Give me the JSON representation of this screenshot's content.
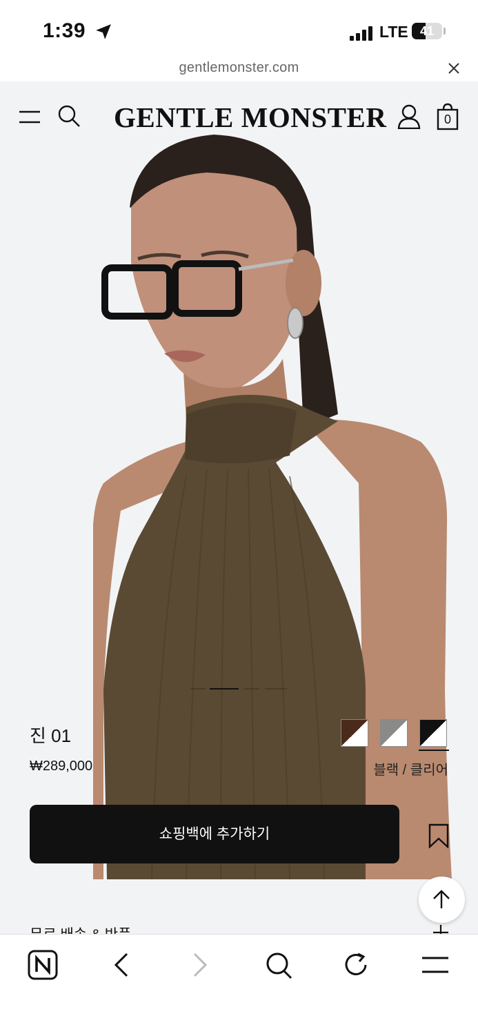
{
  "status_bar": {
    "time": "1:39",
    "network": "LTE",
    "battery": "41"
  },
  "browser": {
    "url": "gentlemonster.com"
  },
  "site": {
    "brand": "GENTLE MONSTER",
    "cart_count": "0"
  },
  "product": {
    "name": "진 01",
    "price": "₩289,000",
    "selected_color": "블랙 / 클리어",
    "add_to_bag": "쇼핑백에 추가하기",
    "swatches": [
      {
        "color_a": "#4a2a1a",
        "color_b": "#ffffff"
      },
      {
        "color_a": "#8a8a88",
        "color_b": "#ffffff"
      },
      {
        "color_a": "#111111",
        "color_b": "#ffffff"
      }
    ],
    "image_count": 4,
    "image_index": 1
  },
  "section": {
    "shipping_title": "무료 배송 & 반품"
  },
  "colors": {
    "accent": "#111111",
    "page_bg": "#f2f3f5",
    "dress": "#5a4a33",
    "skin": "#b98a6f"
  }
}
